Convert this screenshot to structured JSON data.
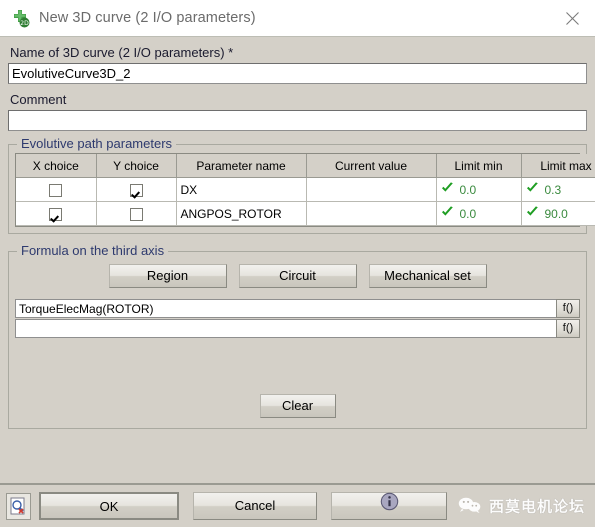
{
  "window": {
    "title": "New 3D curve (2 I/O parameters)",
    "icon": "curve3d-icon",
    "close_label": "✕"
  },
  "name_field": {
    "label": "Name of 3D curve (2 I/O parameters) *",
    "value": "EvolutiveCurve3D_2",
    "placeholder": ""
  },
  "comment_field": {
    "label": "Comment",
    "value": "",
    "placeholder": ""
  },
  "evolutive_group": {
    "title": "Evolutive path parameters",
    "columns": [
      "X choice",
      "Y choice",
      "Parameter name",
      "Current value",
      "Limit min",
      "Limit max"
    ],
    "rows": [
      {
        "x_choice": false,
        "y_choice": true,
        "parameter_name": "DX",
        "current_value": "",
        "limit_min": "0.0",
        "limit_max": "0.3",
        "limit_min_status": "valid",
        "limit_max_status": "valid"
      },
      {
        "x_choice": true,
        "y_choice": false,
        "parameter_name": "ANGPOS_ROTOR",
        "current_value": "",
        "limit_min": "0.0",
        "limit_max": "90.0",
        "limit_min_status": "valid",
        "limit_max_status": "valid"
      }
    ]
  },
  "formula_group": {
    "title": "Formula on the third axis",
    "buttons": {
      "region": "Region",
      "circuit": "Circuit",
      "mechanical_set": "Mechanical set"
    },
    "inputs": [
      {
        "value": "TorqueElecMag(ROTOR)",
        "fbutton": "f()"
      },
      {
        "value": "",
        "fbutton": "f()"
      }
    ],
    "clear_label": "Clear"
  },
  "footer": {
    "preview_icon": "preview-document-icon",
    "ok_label": "OK",
    "cancel_label": "Cancel",
    "info_icon": "info-circle-icon",
    "watermark_text": "西莫电机论坛",
    "watermark_icon": "wechat-icon"
  },
  "colors": {
    "dialog_bg": "#d4d0c8",
    "titlebar_bg": "#ffffff",
    "group_label": "#2e3a6e",
    "valid_green": "#3a8a3e",
    "icon_green": "#4caf50"
  }
}
